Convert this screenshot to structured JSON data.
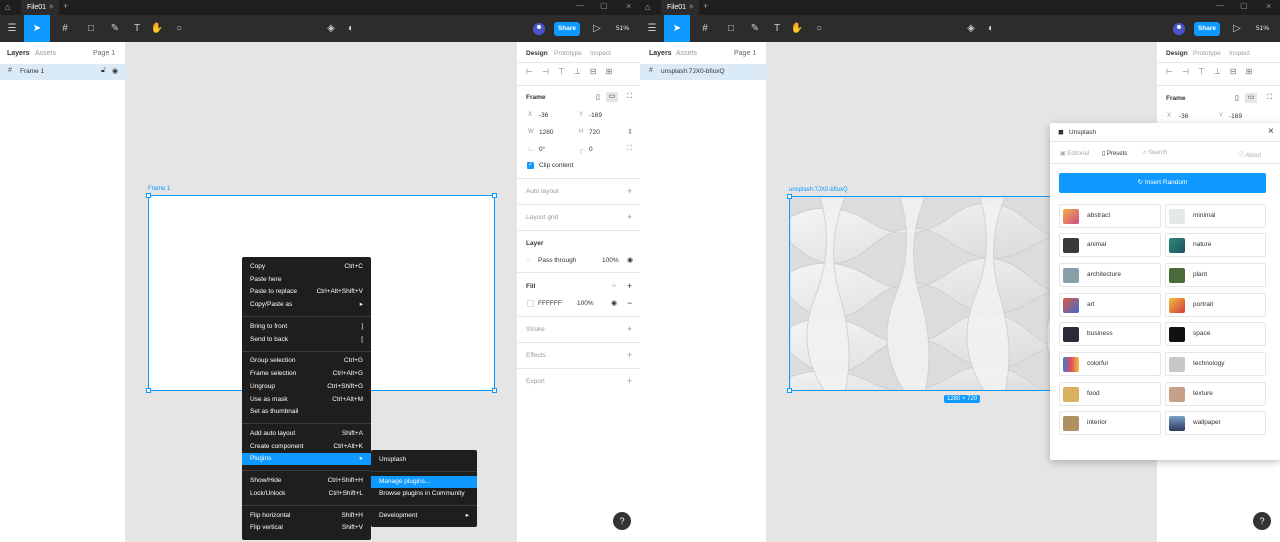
{
  "app": {
    "file_name": "File01",
    "zoom": "51%",
    "share_label": "Share",
    "accent_color": "#0d99ff"
  },
  "left_window": {
    "panel_tabs": {
      "layers": "Layers",
      "assets": "Assets",
      "page": "Page 1"
    },
    "layer_item": "Frame 1",
    "frame_label": "Frame 1",
    "context_menu": {
      "items": [
        {
          "label": "Copy",
          "shortcut": "Ctrl+C"
        },
        {
          "label": "Paste here",
          "shortcut": ""
        },
        {
          "label": "Paste to replace",
          "shortcut": "Ctrl+Alt+Shift+V"
        },
        {
          "label": "Copy/Paste as",
          "shortcut": "▸"
        },
        {
          "label": "Bring to front",
          "shortcut": "]"
        },
        {
          "label": "Send to back",
          "shortcut": "["
        },
        {
          "label": "Group selection",
          "shortcut": "Ctrl+G"
        },
        {
          "label": "Frame selection",
          "shortcut": "Ctrl+Alt+G"
        },
        {
          "label": "Ungroup",
          "shortcut": "Ctrl+Shift+G"
        },
        {
          "label": "Use as mask",
          "shortcut": "Ctrl+Alt+M"
        },
        {
          "label": "Set as thumbnail",
          "shortcut": ""
        },
        {
          "label": "Add auto layout",
          "shortcut": "Shift+A"
        },
        {
          "label": "Create component",
          "shortcut": "Ctrl+Alt+K"
        },
        {
          "label": "Plugins",
          "shortcut": "▸"
        },
        {
          "label": "Show/Hide",
          "shortcut": "Ctrl+Shift+H"
        },
        {
          "label": "Lock/Unlock",
          "shortcut": "Ctrl+Shift+L"
        },
        {
          "label": "Flip horizontal",
          "shortcut": "Shift+H"
        },
        {
          "label": "Flip vertical",
          "shortcut": "Shift+V"
        }
      ]
    },
    "submenu": {
      "items": [
        {
          "label": "Unsplash"
        },
        {
          "label": "Manage plugins..."
        },
        {
          "label": "Browse plugins in Community"
        },
        {
          "label": "Development",
          "arrow": "▸"
        }
      ]
    },
    "design_panel": {
      "tabs": {
        "design": "Design",
        "prototype": "Prototype",
        "inspect": "Inspect"
      },
      "frame_title": "Frame",
      "x_label": "X",
      "x": "-36",
      "y_label": "Y",
      "y": "-169",
      "w_label": "W",
      "w": "1280",
      "h_label": "H",
      "h": "720",
      "rotation": "0°",
      "radius": "0",
      "clip_content": "Clip content",
      "auto_layout": "Auto layout",
      "layout_grid": "Layout grid",
      "layer_title": "Layer",
      "blend": "Pass through",
      "opacity": "100%",
      "fill_title": "Fill",
      "fill_hex": "FFFFFF",
      "fill_opacity": "100%",
      "stroke": "Stroke",
      "effects": "Effects",
      "export": "Export"
    },
    "help": "?"
  },
  "right_window": {
    "panel_tabs": {
      "layers": "Layers",
      "assets": "Assets",
      "page": "Page 1"
    },
    "layer_item": "unsplash:7JX0-bfiuxQ",
    "frame_label": "unsplash:7JX0-bfiuxQ",
    "size_badge": "1280 × 720",
    "design_tabs": {
      "design": "Design",
      "prototype": "Prototype",
      "inspect": "Inspect"
    },
    "frame_title": "Frame",
    "x": "-36",
    "y": "-169",
    "x_label": "X",
    "y_label": "Y",
    "help": "?"
  },
  "plugin": {
    "title": "Unsplash",
    "nav": {
      "editorial": "Editorial",
      "presets": "Presets",
      "search": "Search",
      "about": "About"
    },
    "insert_random": "Insert Random",
    "presets": [
      {
        "label": "abstract",
        "color": "#e0745a"
      },
      {
        "label": "minimal",
        "color": "#d9dfe0"
      },
      {
        "label": "animal",
        "color": "#3a3a3a"
      },
      {
        "label": "nature",
        "color": "#2f8a79"
      },
      {
        "label": "architecture",
        "color": "#8aa0a8"
      },
      {
        "label": "plant",
        "color": "#4a6b3a"
      },
      {
        "label": "art",
        "color": "#e05a3a"
      },
      {
        "label": "portrait",
        "color": "#d26a3a"
      },
      {
        "label": "business",
        "color": "#2a2a3a"
      },
      {
        "label": "space",
        "color": "#1a1a1a"
      },
      {
        "label": "colorful",
        "color": "#3a7ad6"
      },
      {
        "label": "technology",
        "color": "#c8c8c8"
      },
      {
        "label": "food",
        "color": "#d8b060"
      },
      {
        "label": "texture",
        "color": "#c8a088"
      },
      {
        "label": "interior",
        "color": "#b09060"
      },
      {
        "label": "wallpaper",
        "color": "#3a5a7a"
      }
    ]
  }
}
